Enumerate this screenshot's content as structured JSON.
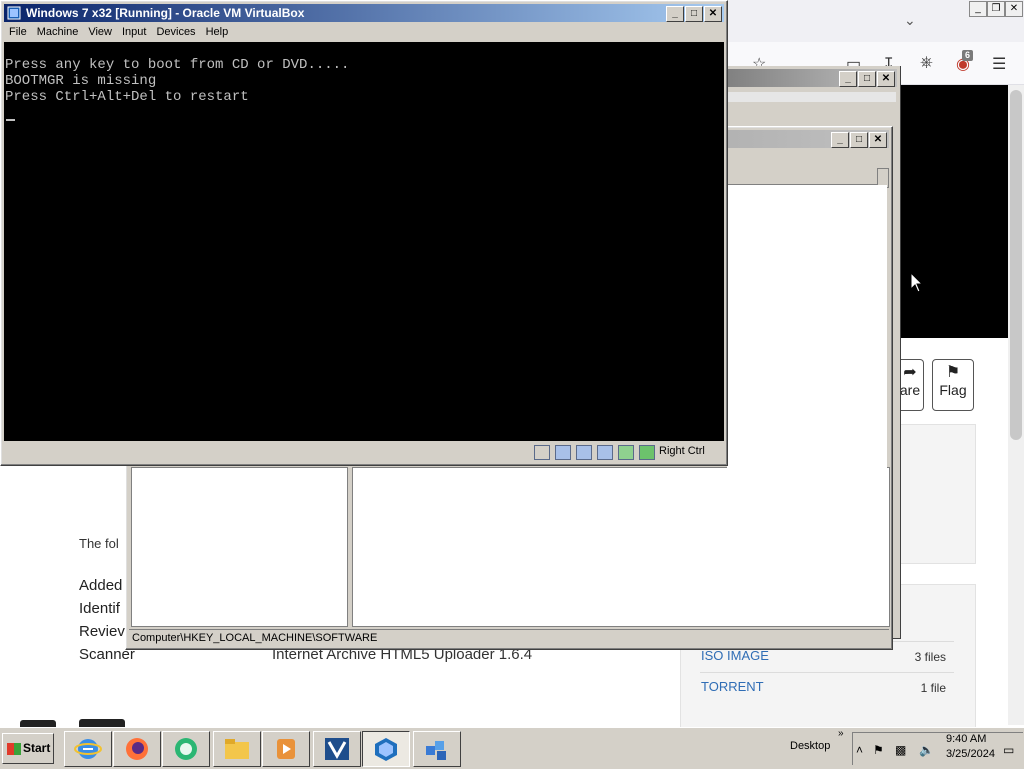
{
  "vbox": {
    "title": "Windows 7 x32 [Running] - Oracle VM VirtualBox",
    "menu": [
      "File",
      "Machine",
      "View",
      "Input",
      "Devices",
      "Help"
    ],
    "console_lines": [
      "Press any key to boot from CD or DVD.....",
      "BOOTMGR is missing",
      "Press Ctrl+Alt+Del to restart"
    ],
    "host_key": "Right Ctrl"
  },
  "regedit": {
    "status_path": "Computer\\HKEY_LOCAL_MACHINE\\SOFTWARE"
  },
  "browser": {
    "tab_badge": "6",
    "buttons": {
      "share_partial": "are",
      "flag": "Flag"
    },
    "note": "The fol",
    "meta_keys": [
      "Added",
      "Identif",
      "Reviev",
      "Scanner"
    ],
    "scanner_value": "Internet Archive HTML5 Uploader 1.6.4",
    "downloads": [
      {
        "label": "ISO IMAGE",
        "count": "3 files"
      },
      {
        "label": "TORRENT",
        "count": "1 file"
      }
    ]
  },
  "taskbar": {
    "start": "Start",
    "desktop": "Desktop",
    "time": "9:40 AM",
    "date": "3/25/2024"
  }
}
